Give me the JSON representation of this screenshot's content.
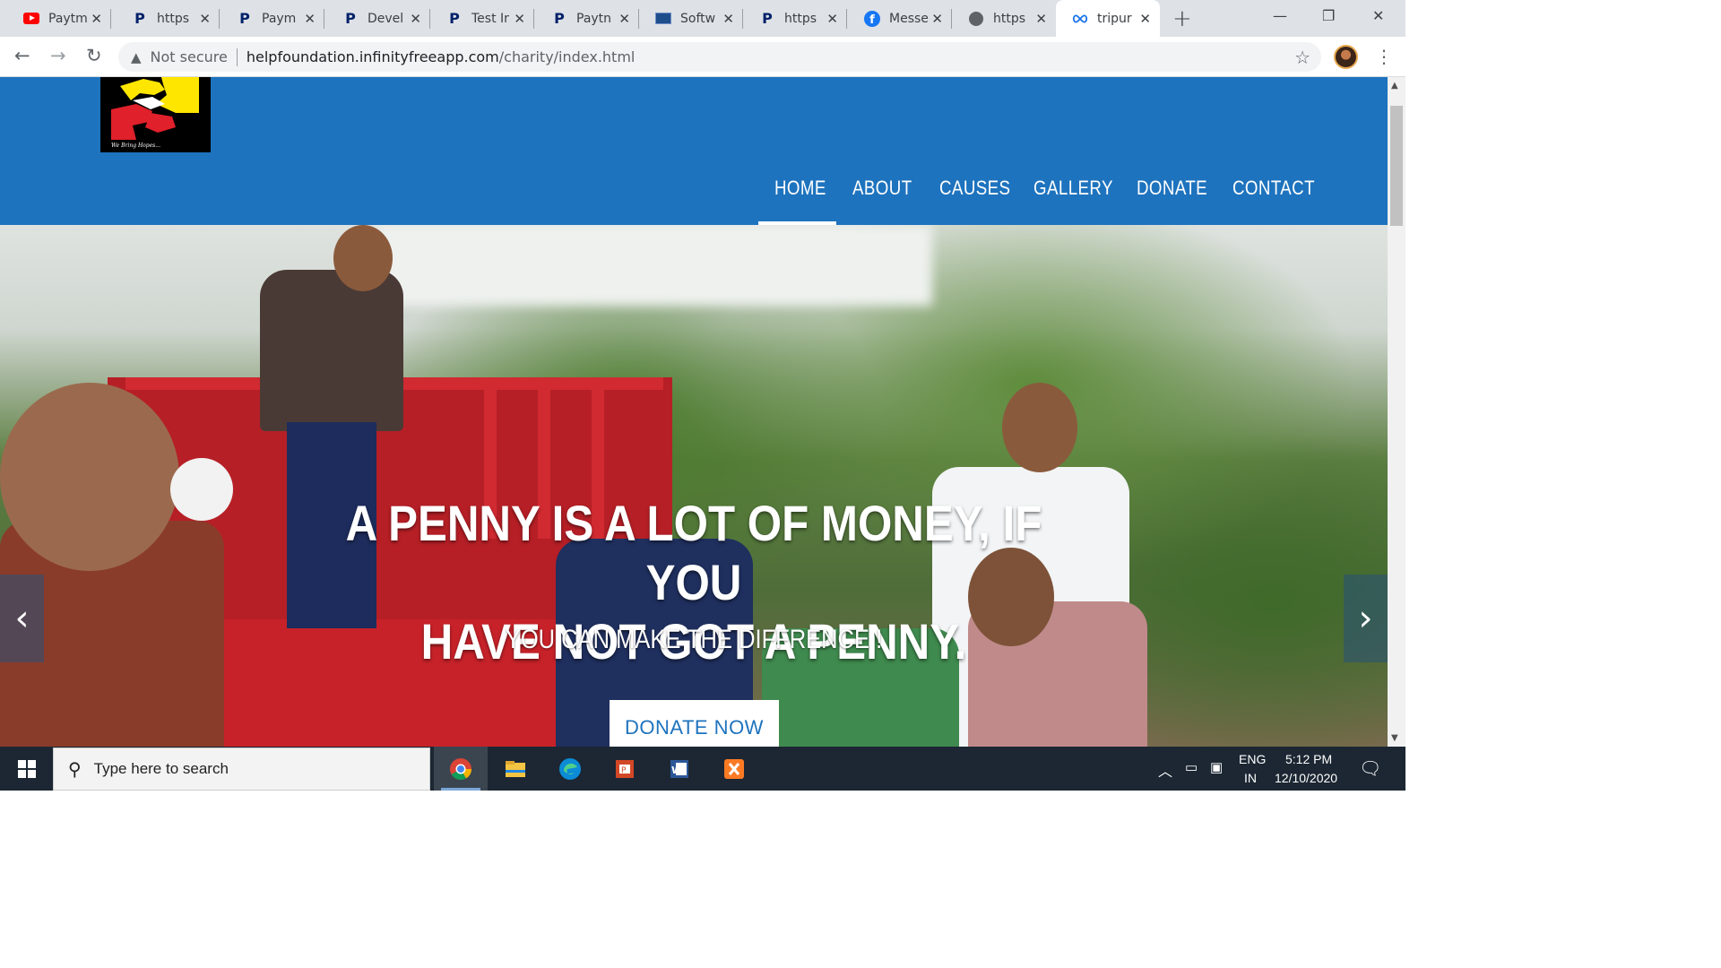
{
  "browser": {
    "tabs": [
      {
        "title": "Paytm",
        "icon": "youtube-icon"
      },
      {
        "title": "https",
        "icon": "paypal-icon"
      },
      {
        "title": "Paym",
        "icon": "paypal-icon"
      },
      {
        "title": "Devel",
        "icon": "paypal-icon"
      },
      {
        "title": "Test Ir",
        "icon": "paypal-icon"
      },
      {
        "title": "Paytn",
        "icon": "paypal-icon"
      },
      {
        "title": "Softw",
        "icon": "software-icon"
      },
      {
        "title": "https",
        "icon": "paypal-icon"
      },
      {
        "title": "Messe",
        "icon": "facebook-icon"
      },
      {
        "title": "https",
        "icon": "globe-icon"
      },
      {
        "title": "tripur",
        "icon": "infinity-icon",
        "active": true
      }
    ],
    "security_label": "Not secure",
    "url_host": "helpfoundation.infinityfreeapp.com",
    "url_path": "/charity/index.html"
  },
  "site": {
    "logo_tagline": "We Bring Hopes...",
    "nav": [
      "HOME",
      "ABOUT",
      "CAUSES",
      "GALLERY",
      "DONATE",
      "CONTACT"
    ],
    "active_nav": "HOME",
    "hero": {
      "title_line1": "A PENNY IS A LOT OF MONEY, IF YOU",
      "title_line2": "HAVE NOT GOT A PENNY.",
      "subtitle": "YOU CAN MAKE THE DIFFRENCE !",
      "cta": "DONATE NOW",
      "prev_icon": "chevron-left-icon",
      "next_icon": "chevron-right-icon"
    },
    "colors": {
      "header_blue": "#1e73be",
      "logo_yellow": "#ffe600",
      "logo_red": "#e0202a"
    }
  },
  "taskbar": {
    "search_placeholder": "Type here to search",
    "apps": [
      "chrome-icon",
      "file-explorer-icon",
      "edge-icon",
      "powerpoint-icon",
      "word-icon",
      "xampp-icon"
    ],
    "lang_line1": "ENG",
    "lang_line2": "IN",
    "time": "5:12 PM",
    "date": "12/10/2020"
  }
}
